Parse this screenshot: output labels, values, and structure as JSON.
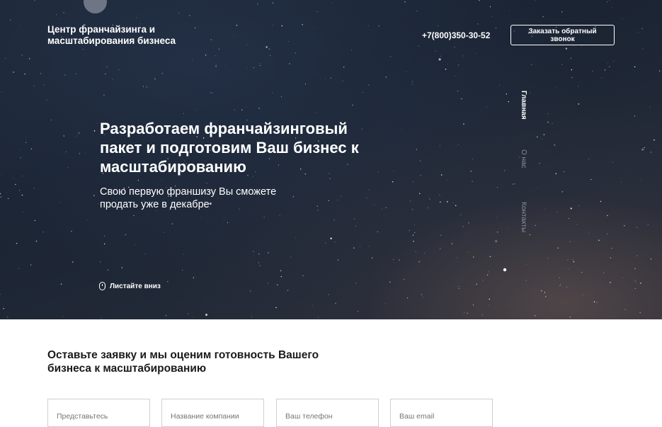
{
  "header": {
    "brand": "Центр франчайзинга и масштабирования бизнеса",
    "phone": "+7(800)350-30-52",
    "callback_button": "Заказать обратный звонок"
  },
  "hero": {
    "headline": "Разработаем франчайзинговый пакет и подготовим Ваш бизнес к масштабированию",
    "subheadline": "Свою первую франшизу Вы сможете продать уже в декабре",
    "scroll_hint": "Листайте вниз"
  },
  "side_nav": {
    "items": [
      "Главная",
      "О нас",
      "Контакты"
    ],
    "active": "Главная"
  },
  "form": {
    "title": "Оставьте заявку и мы оценим готовность Вашего бизнеса к масштабированию",
    "fields": [
      {
        "placeholder": "Представьтесь"
      },
      {
        "placeholder": "Название компании"
      },
      {
        "placeholder": "Ваш телефон"
      },
      {
        "placeholder": "Ваш email"
      }
    ]
  },
  "icons": {
    "scroll": "mouse-icon"
  }
}
